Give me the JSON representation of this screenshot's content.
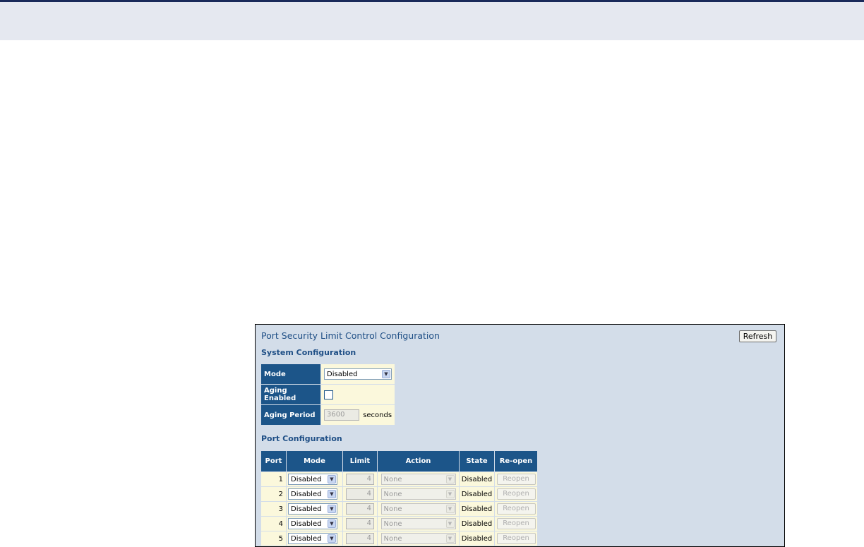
{
  "page": {
    "title": "Port Security Limit Control Configuration",
    "refresh_label": "Refresh"
  },
  "system": {
    "heading": "System Configuration",
    "mode_label": "Mode",
    "mode_value": "Disabled",
    "aging_enabled_label": "Aging Enabled",
    "aging_enabled_checked": false,
    "aging_period_label": "Aging Period",
    "aging_period_value": "3600",
    "aging_period_unit": "seconds"
  },
  "ports": {
    "heading": "Port Configuration",
    "columns": [
      "Port",
      "Mode",
      "Limit",
      "Action",
      "State",
      "Re-open"
    ],
    "rows": [
      {
        "port": "1",
        "mode": "Disabled",
        "limit": "4",
        "action": "None",
        "state": "Disabled",
        "reopen": "Reopen"
      },
      {
        "port": "2",
        "mode": "Disabled",
        "limit": "4",
        "action": "None",
        "state": "Disabled",
        "reopen": "Reopen"
      },
      {
        "port": "3",
        "mode": "Disabled",
        "limit": "4",
        "action": "None",
        "state": "Disabled",
        "reopen": "Reopen"
      },
      {
        "port": "4",
        "mode": "Disabled",
        "limit": "4",
        "action": "None",
        "state": "Disabled",
        "reopen": "Reopen"
      },
      {
        "port": "5",
        "mode": "Disabled",
        "limit": "4",
        "action": "None",
        "state": "Disabled",
        "reopen": "Reopen"
      }
    ]
  },
  "icons": {
    "dropdown": "chevron-down-icon"
  }
}
